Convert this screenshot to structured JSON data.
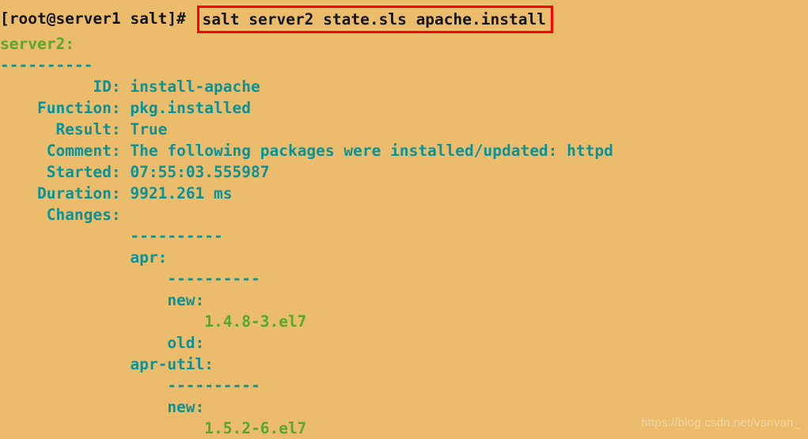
{
  "terminal": {
    "background_color": "#ebbc6b",
    "prompt": "[root@server1 salt]# ",
    "command": "salt server2 state.sls apache.install",
    "command_box_color": "#ff0000",
    "colors": {
      "black": "#141414",
      "teal": "#0a9396",
      "green": "#5aa82b"
    },
    "output": {
      "minion_header": "server2:",
      "separator_top": "----------",
      "fields": [
        {
          "label": "          ID: ",
          "value": "install-apache"
        },
        {
          "label": "    Function: ",
          "value": "pkg.installed"
        },
        {
          "label": "      Result: ",
          "value": "True"
        },
        {
          "label": "     Comment: ",
          "value": "The following packages were installed/updated: httpd"
        },
        {
          "label": "     Started: ",
          "value": "07:55:03.555987"
        },
        {
          "label": "    Duration: ",
          "value": "9921.261 ms"
        },
        {
          "label": "     Changes: ",
          "value": ""
        }
      ],
      "changes": {
        "separator": "              ----------",
        "packages": [
          {
            "name": "              apr:",
            "separator": "                  ----------",
            "entries": [
              {
                "key": "                  new:",
                "value": "                      1.4.8-3.el7"
              },
              {
                "key": "                  old:",
                "value": ""
              }
            ]
          },
          {
            "name": "              apr-util:",
            "separator": "                  ----------",
            "entries": [
              {
                "key": "                  new:",
                "value": "                      1.5.2-6.el7"
              }
            ]
          }
        ]
      }
    },
    "watermark": "https://blog.csdn.net/vanvan_"
  }
}
